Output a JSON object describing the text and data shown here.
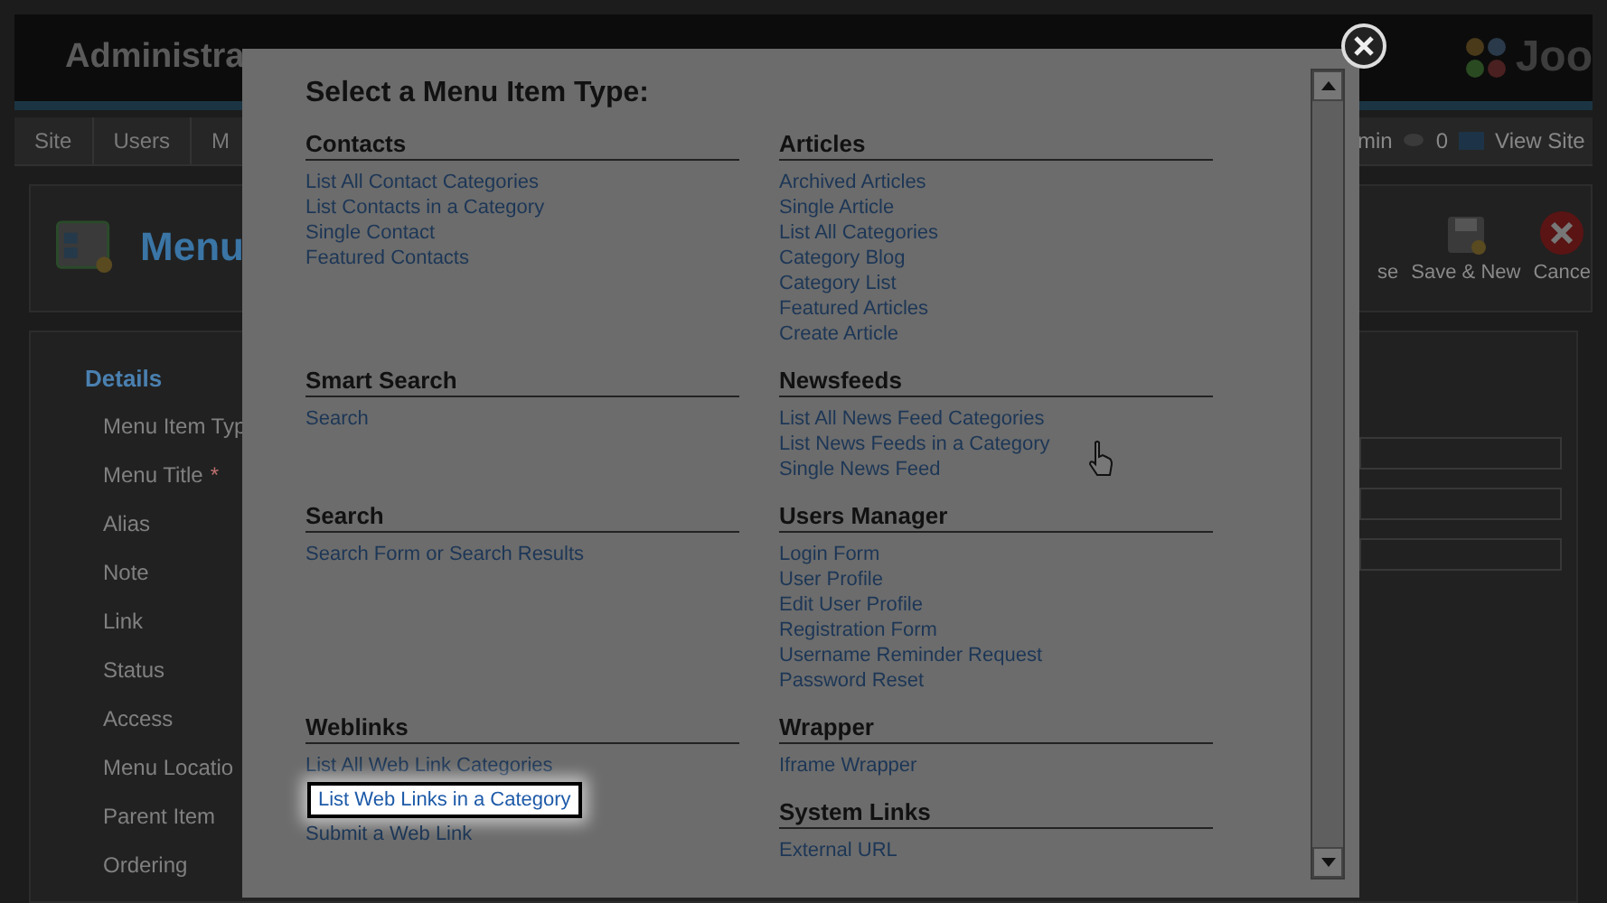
{
  "header": {
    "title": "Administra",
    "logo_text": "Joo"
  },
  "nav": {
    "items": [
      "Site",
      "Users",
      "M"
    ],
    "user": "min",
    "count": "0",
    "view_site": "View Site"
  },
  "toolbar": {
    "title": "Menu",
    "buttons": [
      {
        "kind": "plain",
        "label": "se"
      },
      {
        "kind": "save-new",
        "label": "Save & New"
      },
      {
        "kind": "cancel",
        "label": "Cance"
      }
    ]
  },
  "form": {
    "legend": "Details",
    "required_mark": "*",
    "fields": [
      {
        "label": "Menu Item Typ",
        "required": false
      },
      {
        "label": "Menu Title",
        "required": true
      },
      {
        "label": "Alias",
        "required": false
      },
      {
        "label": "Note",
        "required": false
      },
      {
        "label": "Link",
        "required": false
      },
      {
        "label": "Status",
        "required": false
      },
      {
        "label": "Access",
        "required": false
      },
      {
        "label": "Menu Locatio",
        "required": false
      },
      {
        "label": "Parent Item",
        "required": false
      },
      {
        "label": "Ordering",
        "required": false
      }
    ]
  },
  "modal": {
    "title": "Select a Menu Item Type:",
    "columns": [
      {
        "sections": [
          {
            "heading": "Contacts",
            "links": [
              {
                "label": "List All Contact Categories",
                "selected": false
              },
              {
                "label": "List Contacts in a Category",
                "selected": false
              },
              {
                "label": "Single Contact",
                "selected": false
              },
              {
                "label": "Featured Contacts",
                "selected": false
              }
            ]
          },
          {
            "heading": "Smart Search",
            "links": [
              {
                "label": "Search",
                "selected": false
              }
            ]
          },
          {
            "heading": "Search",
            "links": [
              {
                "label": "Search Form or Search Results",
                "selected": false
              }
            ]
          },
          {
            "heading": "Weblinks",
            "links": [
              {
                "label": "List All Web Link Categories",
                "selected": false
              },
              {
                "label": "List Web Links in a Category",
                "selected": true
              },
              {
                "label": "Submit a Web Link",
                "selected": false
              }
            ]
          }
        ]
      },
      {
        "sections": [
          {
            "heading": "Articles",
            "links": [
              {
                "label": "Archived Articles",
                "selected": false
              },
              {
                "label": "Single Article",
                "selected": false
              },
              {
                "label": "List All Categories",
                "selected": false
              },
              {
                "label": "Category Blog",
                "selected": false
              },
              {
                "label": "Category List",
                "selected": false
              },
              {
                "label": "Featured Articles",
                "selected": false
              },
              {
                "label": "Create Article",
                "selected": false
              }
            ]
          },
          {
            "heading": "Newsfeeds",
            "links": [
              {
                "label": "List All News Feed Categories",
                "selected": false
              },
              {
                "label": "List News Feeds in a Category",
                "selected": false
              },
              {
                "label": "Single News Feed",
                "selected": false
              }
            ]
          },
          {
            "heading": "Users Manager",
            "links": [
              {
                "label": "Login Form",
                "selected": false
              },
              {
                "label": "User Profile",
                "selected": false
              },
              {
                "label": "Edit User Profile",
                "selected": false
              },
              {
                "label": "Registration Form",
                "selected": false
              },
              {
                "label": "Username Reminder Request",
                "selected": false
              },
              {
                "label": "Password Reset",
                "selected": false
              }
            ]
          },
          {
            "heading": "Wrapper",
            "links": [
              {
                "label": "Iframe Wrapper",
                "selected": false
              }
            ]
          },
          {
            "heading": "System Links",
            "links": [
              {
                "label": "External URL",
                "selected": false
              }
            ]
          }
        ]
      }
    ]
  }
}
